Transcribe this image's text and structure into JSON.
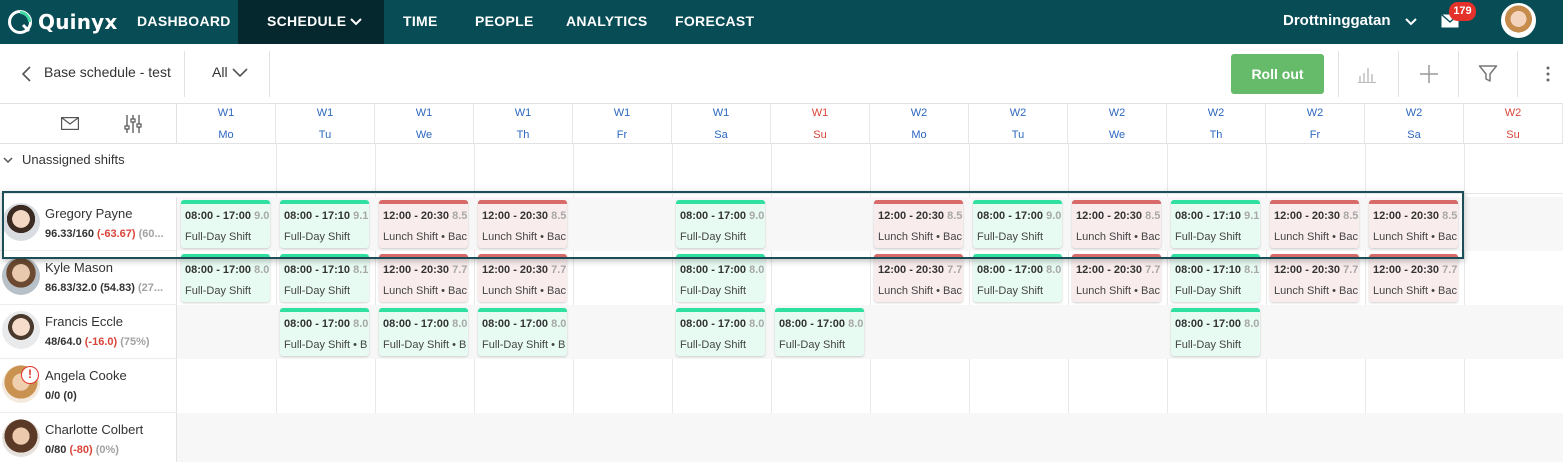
{
  "app": {
    "name": "Quinyx",
    "brand_color": "#084c55",
    "active_nav_bg": "#04282d"
  },
  "nav": {
    "items": [
      "DASHBOARD",
      "SCHEDULE",
      "TIME",
      "PEOPLE",
      "ANALYTICS",
      "FORECAST"
    ],
    "active": "SCHEDULE",
    "location": "Drottninggatan",
    "mail_count": "179"
  },
  "toolbar": {
    "breadcrumb": "Base schedule - test",
    "filter_value": "All",
    "rollout_label": "Roll out",
    "rollout_color": "#66bb6a"
  },
  "days": [
    {
      "week": "W1",
      "day": "Mo"
    },
    {
      "week": "W1",
      "day": "Tu"
    },
    {
      "week": "W1",
      "day": "We"
    },
    {
      "week": "W1",
      "day": "Th"
    },
    {
      "week": "W1",
      "day": "Fr"
    },
    {
      "week": "W1",
      "day": "Sa"
    },
    {
      "week": "W1",
      "day": "Su"
    },
    {
      "week": "W2",
      "day": "Mo"
    },
    {
      "week": "W2",
      "day": "Tu"
    },
    {
      "week": "W2",
      "day": "We"
    },
    {
      "week": "W2",
      "day": "Th"
    },
    {
      "week": "W2",
      "day": "Fr"
    },
    {
      "week": "W2",
      "day": "Sa"
    },
    {
      "week": "W2",
      "day": "Su"
    }
  ],
  "unassigned_label": "Unassigned shifts",
  "employees": [
    {
      "name": "Gregory Payne",
      "hours": "96.33/160",
      "diff": "(-63.67)",
      "pct": "(60...",
      "shifts": [
        {
          "col": 0,
          "type": "green",
          "time": "08:00 - 17:00",
          "hours": "9.0",
          "label": "Full-Day Shift"
        },
        {
          "col": 1,
          "type": "green",
          "time": "08:00 - 17:10",
          "hours": "9.1",
          "label": "Full-Day Shift"
        },
        {
          "col": 2,
          "type": "red",
          "time": "12:00 - 20:30",
          "hours": "8.5",
          "label": "Lunch Shift • Bac"
        },
        {
          "col": 3,
          "type": "red",
          "time": "12:00 - 20:30",
          "hours": "8.5",
          "label": "Lunch Shift • Bac"
        },
        {
          "col": 5,
          "type": "green",
          "time": "08:00 - 17:00",
          "hours": "9.0",
          "label": "Full-Day Shift"
        },
        {
          "col": 7,
          "type": "red",
          "time": "12:00 - 20:30",
          "hours": "8.5",
          "label": "Lunch Shift • Bac"
        },
        {
          "col": 8,
          "type": "green",
          "time": "08:00 - 17:00",
          "hours": "9.0",
          "label": "Full-Day Shift"
        },
        {
          "col": 9,
          "type": "red",
          "time": "12:00 - 20:30",
          "hours": "8.5",
          "label": "Lunch Shift • Bac"
        },
        {
          "col": 10,
          "type": "green",
          "time": "08:00 - 17:10",
          "hours": "9.1",
          "label": "Full-Day Shift"
        },
        {
          "col": 11,
          "type": "red",
          "time": "12:00 - 20:30",
          "hours": "8.5",
          "label": "Lunch Shift • Bac"
        },
        {
          "col": 12,
          "type": "red",
          "time": "12:00 - 20:30",
          "hours": "8.5",
          "label": "Lunch Shift • Bac"
        }
      ]
    },
    {
      "name": "Kyle Mason",
      "hours": "86.83/32.0",
      "diff": "(54.83)",
      "pct": "(27...",
      "shifts": [
        {
          "col": 0,
          "type": "green",
          "time": "08:00 - 17:00",
          "hours": "8.0",
          "label": "Full-Day Shift"
        },
        {
          "col": 1,
          "type": "green",
          "time": "08:00 - 17:10",
          "hours": "8.1",
          "label": "Full-Day Shift"
        },
        {
          "col": 2,
          "type": "red",
          "time": "12:00 - 20:30",
          "hours": "7.7",
          "label": "Lunch Shift • Bac"
        },
        {
          "col": 3,
          "type": "red",
          "time": "12:00 - 20:30",
          "hours": "7.7",
          "label": "Lunch Shift • Bac"
        },
        {
          "col": 5,
          "type": "green",
          "time": "08:00 - 17:00",
          "hours": "8.0",
          "label": "Full-Day Shift"
        },
        {
          "col": 7,
          "type": "red",
          "time": "12:00 - 20:30",
          "hours": "7.7",
          "label": "Lunch Shift • Bac"
        },
        {
          "col": 8,
          "type": "green",
          "time": "08:00 - 17:00",
          "hours": "8.0",
          "label": "Full-Day Shift"
        },
        {
          "col": 9,
          "type": "red",
          "time": "12:00 - 20:30",
          "hours": "7.7",
          "label": "Lunch Shift • Bac"
        },
        {
          "col": 10,
          "type": "green",
          "time": "08:00 - 17:10",
          "hours": "8.1",
          "label": "Full-Day Shift"
        },
        {
          "col": 11,
          "type": "red",
          "time": "12:00 - 20:30",
          "hours": "7.7",
          "label": "Lunch Shift • Bac"
        },
        {
          "col": 12,
          "type": "red",
          "time": "12:00 - 20:30",
          "hours": "7.7",
          "label": "Lunch Shift • Bac"
        }
      ]
    },
    {
      "name": "Francis Eccle",
      "hours": "48/64.0",
      "diff": "(-16.0)",
      "pct": "(75%)",
      "shifts": [
        {
          "col": 1,
          "type": "green",
          "time": "08:00 - 17:00",
          "hours": "8.0",
          "label": "Full-Day Shift • B"
        },
        {
          "col": 2,
          "type": "green",
          "time": "08:00 - 17:00",
          "hours": "8.0",
          "label": "Full-Day Shift • B"
        },
        {
          "col": 3,
          "type": "green",
          "time": "08:00 - 17:00",
          "hours": "8.0",
          "label": "Full-Day Shift • B"
        },
        {
          "col": 5,
          "type": "green",
          "time": "08:00 - 17:00",
          "hours": "8.0",
          "label": "Full-Day Shift"
        },
        {
          "col": 6,
          "type": "green",
          "time": "08:00 - 17:00",
          "hours": "8.0",
          "label": "Full-Day Shift"
        },
        {
          "col": 10,
          "type": "green",
          "time": "08:00 - 17:00",
          "hours": "8.0",
          "label": "Full-Day Shift"
        }
      ]
    },
    {
      "name": "Angela Cooke",
      "hours": "0/0",
      "diff": "(0)",
      "pct": "",
      "warning": "!",
      "shifts": []
    },
    {
      "name": "Charlotte Colbert",
      "hours": "0/80",
      "diff": "(-80)",
      "pct": "(0%)",
      "shifts": []
    }
  ],
  "colors": {
    "shift_green": "#2fe0a0",
    "shift_red": "#d86a6a",
    "week_label": "#2c67c1",
    "sunday_label": "#d9453a"
  }
}
